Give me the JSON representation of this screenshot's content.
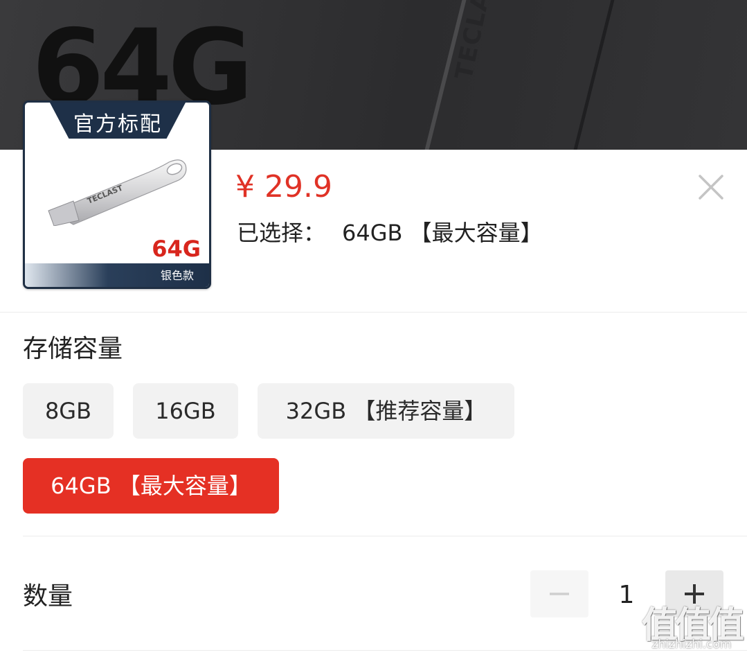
{
  "banner": {
    "big_text": "64G",
    "brand": "TECLAST"
  },
  "product": {
    "thumb_tag": "官方标配",
    "thumb_brand": "TECLAST",
    "thumb_size": "64G",
    "thumb_variant": "银色款",
    "price": "¥ 29.9",
    "selected_label": "已选择：",
    "selected_value": "64GB 【最大容量】"
  },
  "capacity": {
    "title": "存储容量",
    "options": [
      {
        "label": "8GB",
        "selected": false
      },
      {
        "label": "16GB",
        "selected": false
      },
      {
        "label": "32GB 【推荐容量】",
        "selected": false
      },
      {
        "label": "64GB 【最大容量】",
        "selected": true
      }
    ]
  },
  "quantity": {
    "label": "数量",
    "value": "1"
  },
  "watermark": {
    "glyphs": "值值值",
    "domain": "zhizhizhi.com"
  },
  "colors": {
    "accent": "#e53024",
    "price": "#e03226",
    "option_bg": "#f2f2f2",
    "banner_bg": "#2f2f31"
  },
  "icons": {
    "close": "close-icon",
    "minus": "minus-icon",
    "plus": "plus-icon"
  }
}
